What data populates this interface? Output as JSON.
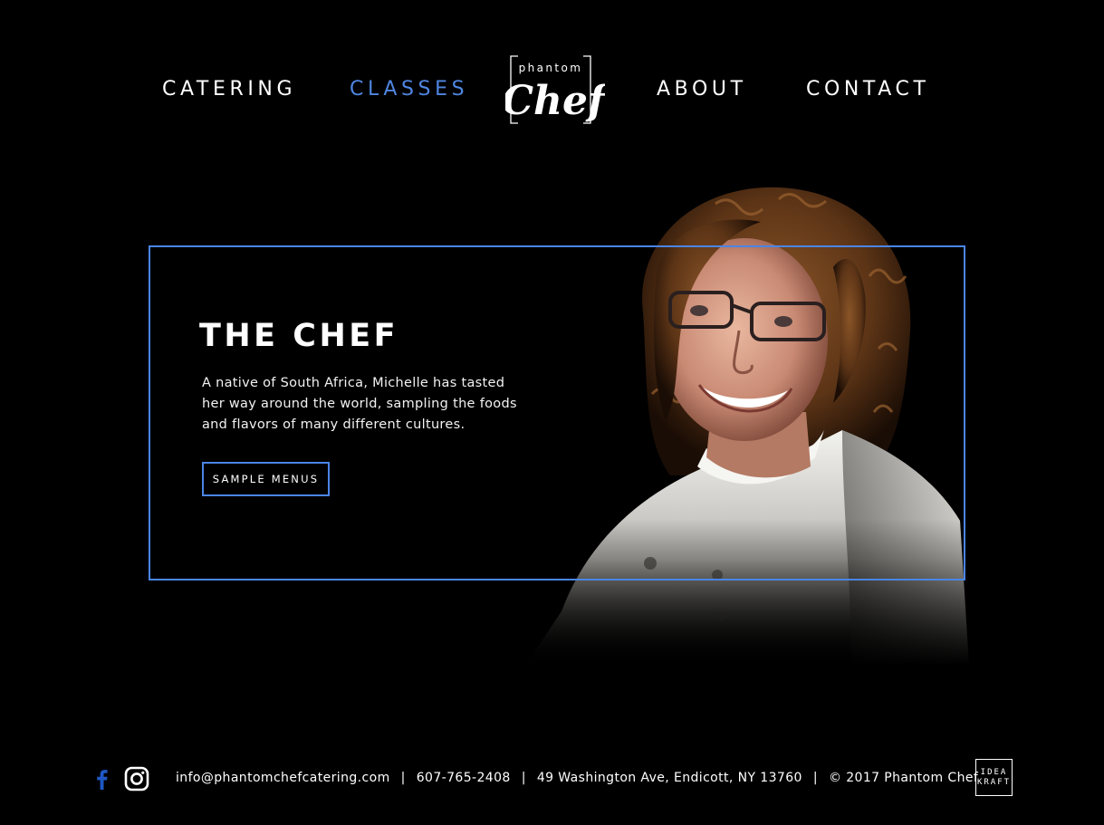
{
  "nav": {
    "items": [
      {
        "label": "CATERING",
        "active": false
      },
      {
        "label": "CLASSES",
        "active": true
      },
      {
        "label": "ABOUT",
        "active": false
      },
      {
        "label": "CONTACT",
        "active": false
      }
    ],
    "active_color": "#4f86e0"
  },
  "logo": {
    "top_text": "phantom",
    "main_text": "Chef"
  },
  "hero": {
    "title": "THE CHEF",
    "text": "A native of South Africa, Michelle has tasted her way around the world, sampling the foods and flavors of many different cultures.",
    "button_label": "SAMPLE MENUS",
    "frame_color": "#4a85e6"
  },
  "footer": {
    "social_icons": [
      "facebook-icon",
      "instagram-icon"
    ],
    "facebook_color": "#1f57c4",
    "email": "info@phantomchefcatering.com",
    "phone": "607-765-2408",
    "address": "49 Washington Ave, Endicott, NY 13760",
    "copyright": "© 2017 Phantom Chef",
    "separator": "|",
    "badge": {
      "line1": "IDEA",
      "line2": "KRAFT"
    }
  }
}
